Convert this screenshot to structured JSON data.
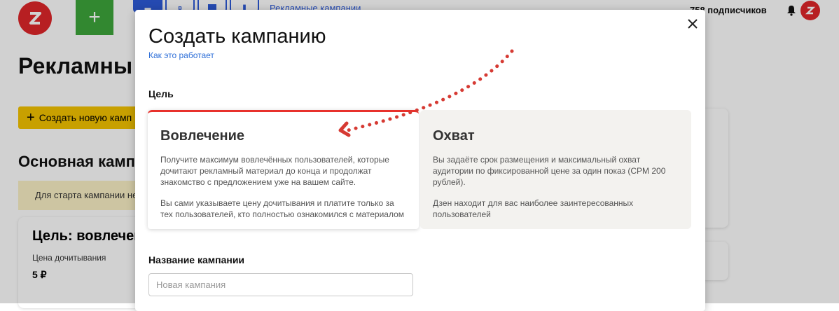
{
  "background": {
    "tabs_link": "Рекламные кампании",
    "subscribers": "758 подписчиков",
    "page_title": "Рекламны",
    "create_new_button": "Создать новую камп",
    "section_title": "Основная кампа",
    "notice_text": "Для старта кампании нео",
    "card": {
      "title": "Цель: вовлечени",
      "price_label": "Цена дочитывания",
      "price_value": "5 ₽"
    }
  },
  "modal": {
    "title": "Создать кампанию",
    "how_it_works_link": "Как это работает",
    "goal_label": "Цель",
    "options": [
      {
        "title": "Вовлечение",
        "selected": true,
        "paragraphs": [
          "Получите максимум вовлечённых пользователей, которые дочитают рекламный материал до конца и продолжат знакомство с предложением уже на вашем сайте.",
          "Вы сами указываете цену дочитывания и платите только за тех пользователей, кто полностью ознакомился с материалом"
        ]
      },
      {
        "title": "Охват",
        "selected": false,
        "paragraphs": [
          "Вы задаёте срок размещения и максимальный охват аудитории по фиксированной цене за один показ (CPM 200 рублей).",
          "Дзен находит для вас наиболее заинтересованных пользователей"
        ]
      }
    ],
    "name_label": "Название кампании",
    "name_placeholder": "Новая кампания",
    "name_value": ""
  },
  "colors": {
    "accent_red": "#e8312c",
    "brand_green": "#3ea63b",
    "brand_yellow": "#f4c400",
    "link_blue": "#2e6fd8"
  }
}
